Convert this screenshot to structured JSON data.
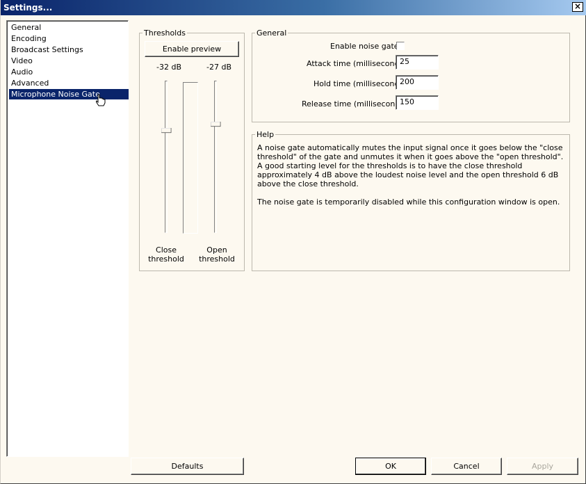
{
  "window": {
    "title": "Settings...",
    "close_glyph": "×"
  },
  "nav": {
    "items": [
      {
        "label": "General"
      },
      {
        "label": "Encoding"
      },
      {
        "label": "Broadcast Settings"
      },
      {
        "label": "Video"
      },
      {
        "label": "Audio"
      },
      {
        "label": "Advanced"
      },
      {
        "label": "Microphone Noise Gate",
        "selected": true
      }
    ]
  },
  "thresholds": {
    "legend": "Thresholds",
    "preview_button": "Enable preview",
    "close_value": "-32 dB",
    "open_value": "-27 dB",
    "close_label_1": "Close",
    "close_label_2": "threshold",
    "open_label_1": "Open",
    "open_label_2": "threshold"
  },
  "general": {
    "legend": "General",
    "enable_label": "Enable noise gate:",
    "enable_checked": false,
    "attack_label": "Attack time (milliseconds):",
    "attack_value": "25",
    "hold_label": "Hold time (milliseconds):",
    "hold_value": "200",
    "release_label": "Release time (milliseconds):",
    "release_value": "150"
  },
  "help": {
    "legend": "Help",
    "paragraph_1": "A noise gate automatically mutes the input signal once it goes below the \"close threshold\" of the gate and unmutes it when it goes above the \"open threshold\". A good starting level for the thresholds is to have the close threshold approximately 4 dB above the loudest noise level and the open threshold 6 dB above the close threshold.",
    "paragraph_2": "The noise gate is temporarily disabled while this configuration window is open."
  },
  "footer": {
    "defaults": "Defaults",
    "ok": "OK",
    "cancel": "Cancel",
    "apply": "Apply"
  },
  "colors": {
    "titlebar_start": "#0a246a",
    "titlebar_end": "#a6caf0",
    "selection": "#0a246a",
    "dialog_bg": "#fdf9f0"
  },
  "icons": {
    "cursor": "hand-pointer-icon",
    "close": "close-icon"
  }
}
